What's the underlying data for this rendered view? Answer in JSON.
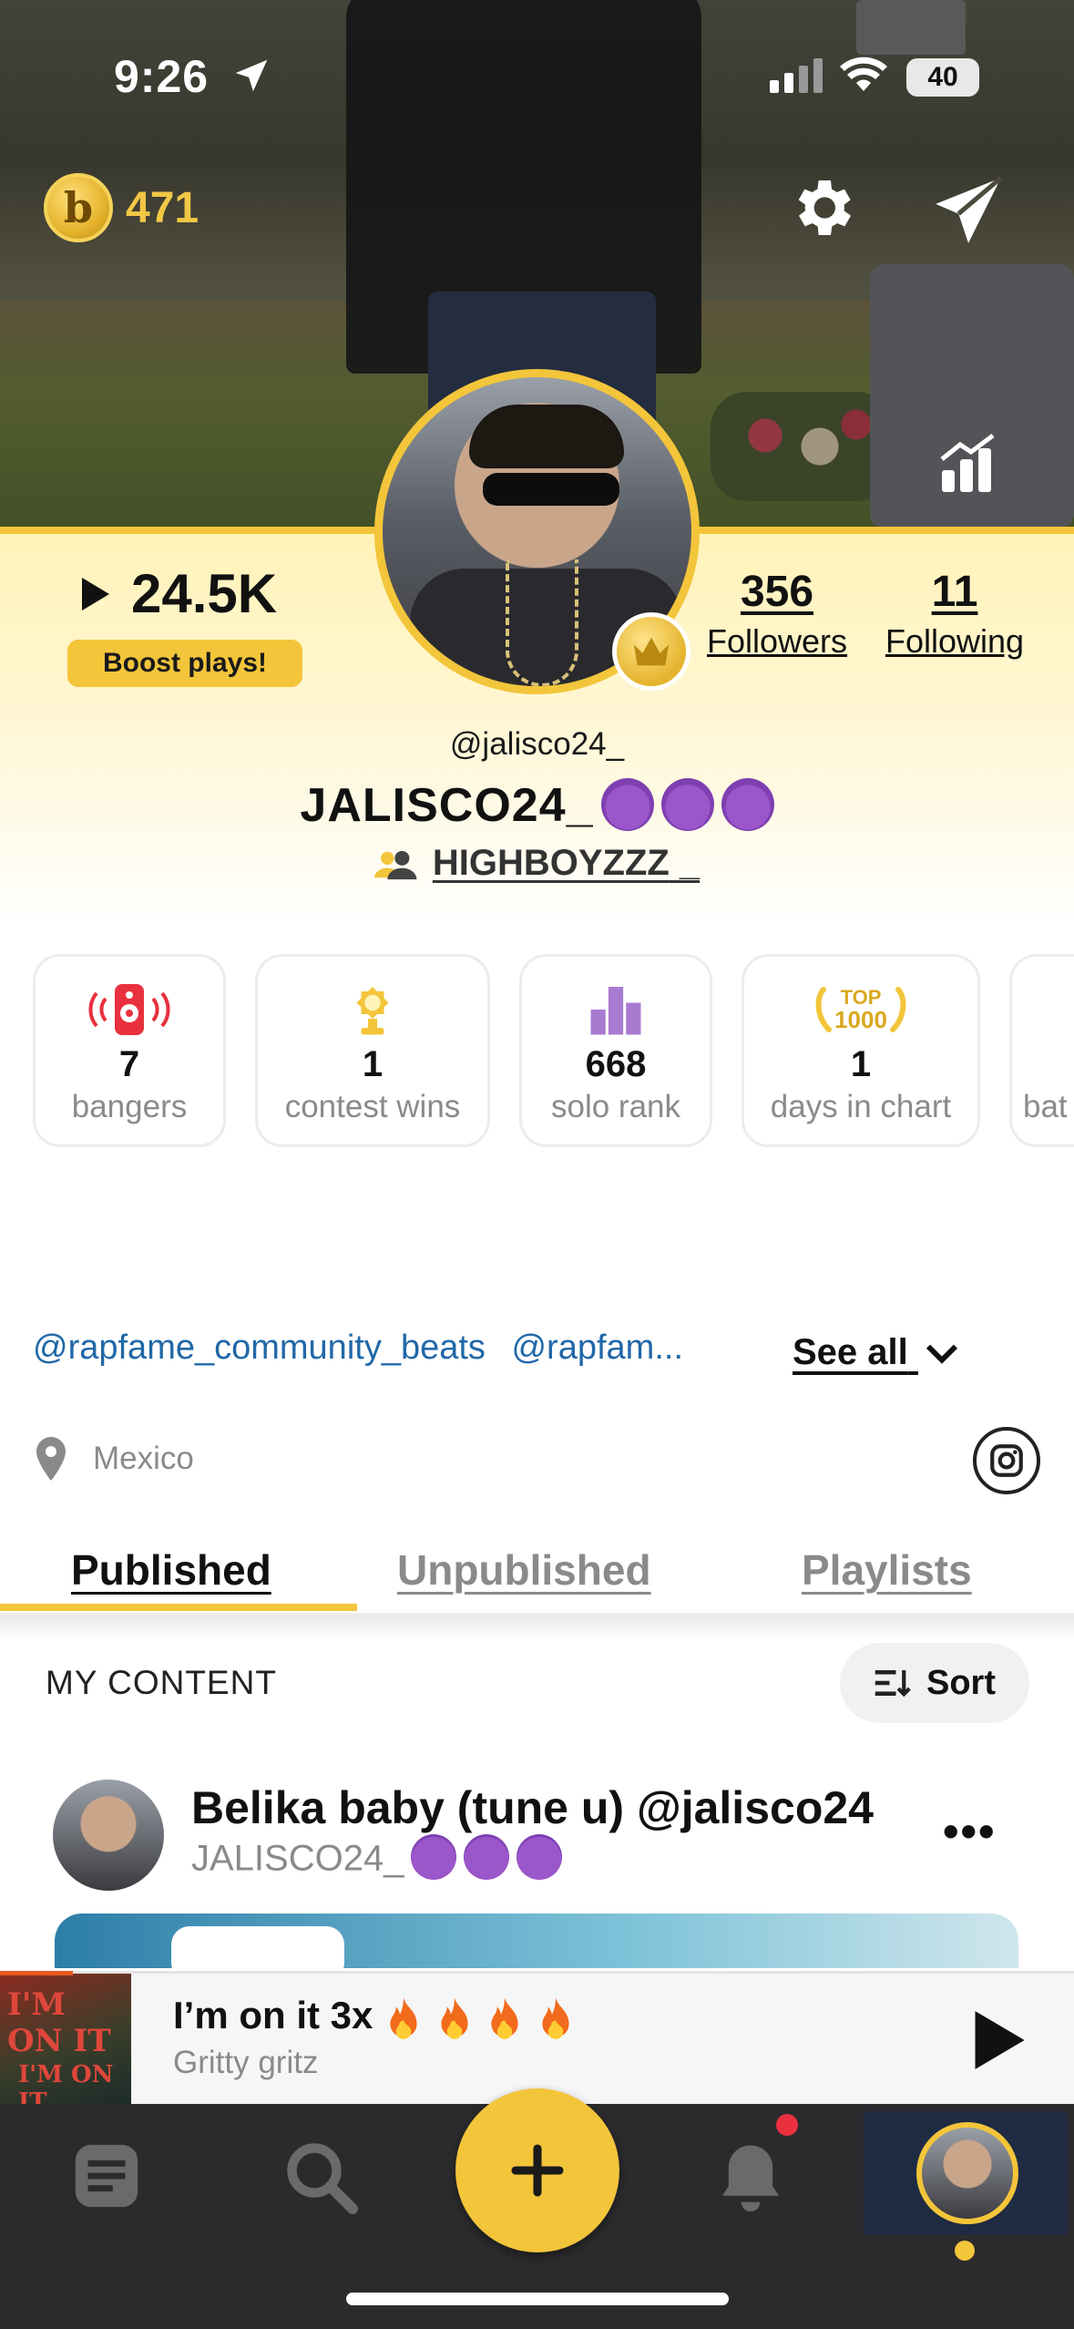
{
  "status_bar": {
    "time": "9:26",
    "battery": "40"
  },
  "top_bar": {
    "coin_symbol": "b",
    "coin_count": "471"
  },
  "profile": {
    "plays": "24.5K",
    "boost_label": "Boost plays!",
    "followers_count": "356",
    "followers_label": "Followers",
    "following_count": "11",
    "following_label": "Following",
    "handle": "@jalisco24_",
    "display_name": "JALISCO24_",
    "crew_name": "HIGHBOYZZZ",
    "crew_suffix": " _"
  },
  "stat_cards": [
    {
      "value": "7",
      "label": "bangers",
      "icon": "speaker-icon"
    },
    {
      "value": "1",
      "label": "contest wins",
      "icon": "trophy-icon"
    },
    {
      "value": "668",
      "label": "solo rank",
      "icon": "rank-bars-icon"
    },
    {
      "value": "1",
      "label": "days in chart",
      "icon": "top1000-icon",
      "icon_text_top": "TOP",
      "icon_text_bottom": "1000"
    },
    {
      "value": "",
      "label": "bat",
      "icon": ""
    }
  ],
  "links": {
    "items": [
      "@rapfame_community_beats",
      "@rapfam..."
    ],
    "see_all": "See all"
  },
  "location": "Mexico",
  "tabs": [
    {
      "label": "Published",
      "active": true
    },
    {
      "label": "Unpublished",
      "active": false
    },
    {
      "label": "Playlists",
      "active": false
    }
  ],
  "content": {
    "section_title": "MY CONTENT",
    "sort_label": "Sort",
    "track_title": "Belika baby (tune u) @jalisco24",
    "track_artist": "JALISCO24_"
  },
  "now_playing": {
    "art_text": "I'M ON IT",
    "title": "I’m on it 3x",
    "artist": "Gritty gritz"
  },
  "colors": {
    "accent": "#f3c53a",
    "link": "#2168a8",
    "notif": "#e8303e"
  }
}
